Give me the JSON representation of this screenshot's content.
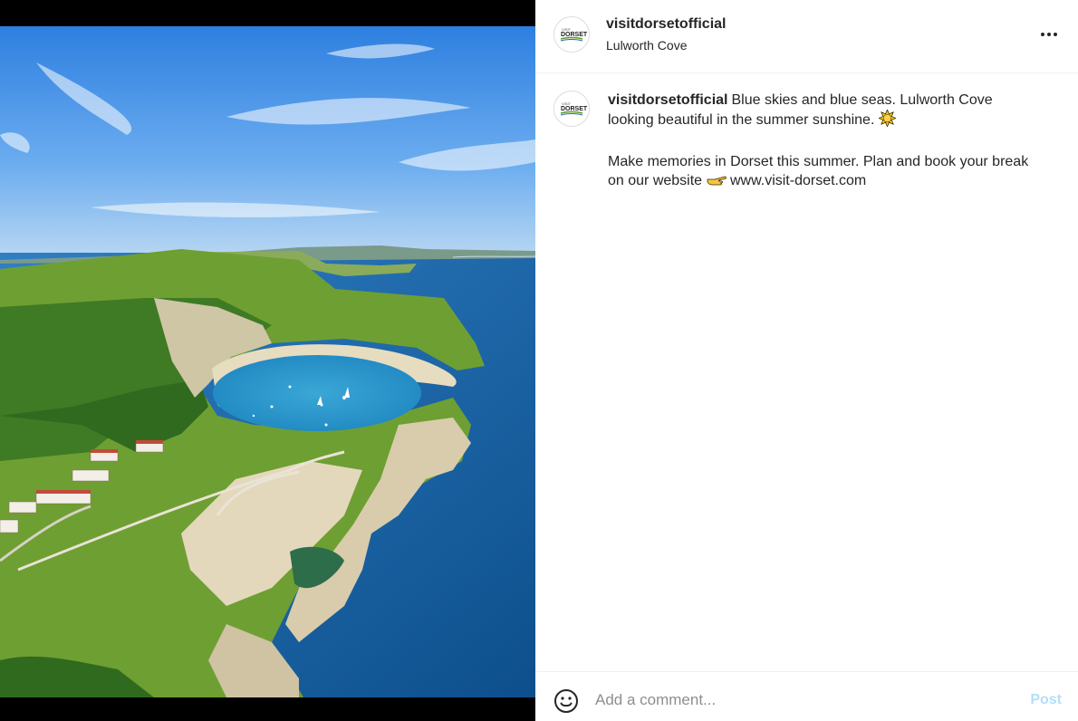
{
  "post": {
    "username": "visitdorsetofficial",
    "location": "Lulworth Cove",
    "avatar_logo": {
      "small": "VISIT",
      "big": "DORSET"
    },
    "photo_alt": "Lulworth Cove, Dorset",
    "caption": {
      "username": "visitdorsetofficial",
      "line1": "Blue skies and blue seas. Lulworth Cove looking beautiful in the summer sunshine.",
      "emoji1": "sun-icon",
      "line2": "Make memories in Dorset this summer. Plan and book your break on our website",
      "emoji2": "pointing-hand-icon",
      "link": "www.visit-dorset.com"
    }
  },
  "footer": {
    "comment_placeholder": "Add a comment...",
    "post_label": "Post"
  },
  "colors": {
    "text": "#262626",
    "muted": "#8e8e8e",
    "post_disabled": "#b2dffc",
    "border": "#efefef"
  }
}
